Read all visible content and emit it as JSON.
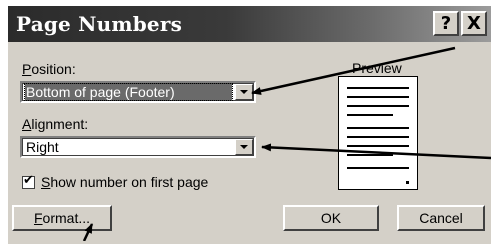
{
  "dialog": {
    "title": "Page Numbers",
    "help_button": "?",
    "close_button": "X"
  },
  "position": {
    "label_accel": "P",
    "label_rest": "osition:",
    "value": "Bottom of page (Footer)"
  },
  "alignment": {
    "label_accel": "A",
    "label_rest": "lignment:",
    "value": "Right"
  },
  "show_first_page": {
    "checked": true,
    "label_accel": "S",
    "label_rest": "how number on first page"
  },
  "preview": {
    "label": "Preview"
  },
  "buttons": {
    "format_accel": "F",
    "format_rest": "ormat...",
    "ok": "OK",
    "cancel": "Cancel"
  },
  "colors": {
    "dialog_face": "#d4d0c8",
    "title_bar_start": "#2b2b2b",
    "title_bar_end": "#9c9c9c",
    "selection": "#6a6a6a"
  }
}
